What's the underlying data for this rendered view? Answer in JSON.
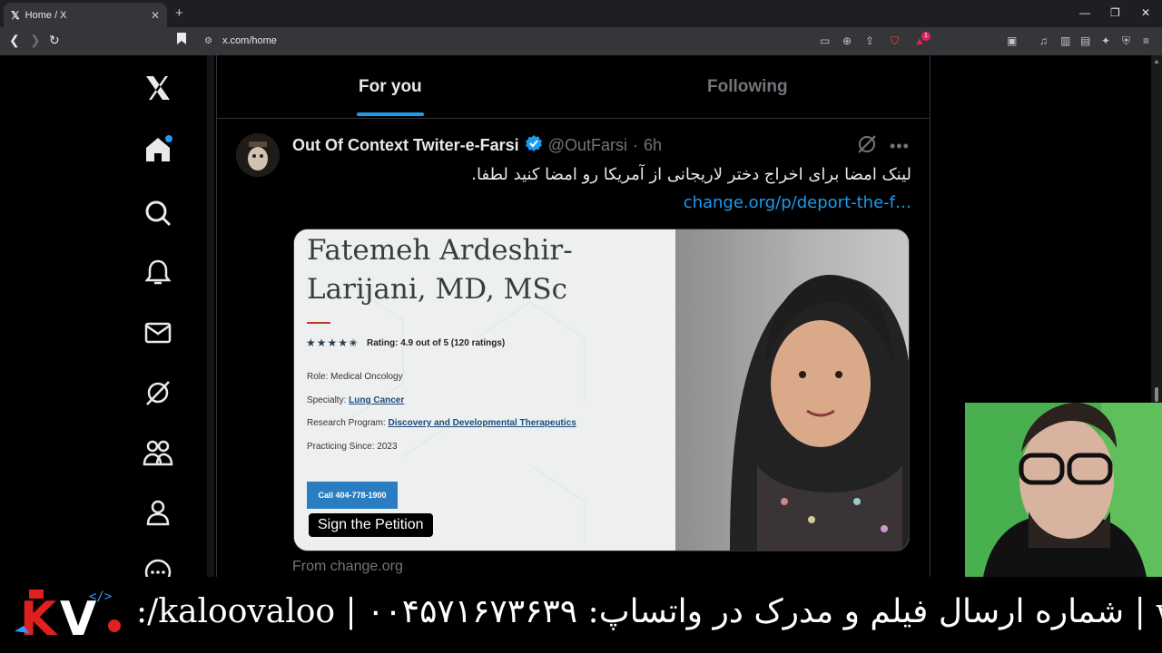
{
  "browser": {
    "tab_title": "Home / X",
    "tab_icon": "x-logo-icon",
    "url": "x.com/home",
    "notification_badge": "1"
  },
  "timeline": {
    "tabs": [
      {
        "label": "For you",
        "active": true
      },
      {
        "label": "Following",
        "active": false
      }
    ]
  },
  "tweet": {
    "author_name": "Out Of Context Twiter-e-Farsi",
    "verified": true,
    "handle": "@OutFarsi",
    "separator": "·",
    "time": "6h",
    "text_prefix": "لینک امضا برای اخراج دختر لاریجانی از آمریکا رو امضا کنید لطفا.",
    "link_text": "change.org/p/deport-the-f…",
    "card": {
      "doctor_name": "Fatemeh Ardeshir-Larijani, MD, MSc",
      "rating_text": "Rating: 4.9 out of 5 (120 ratings)",
      "role_label": "Role: Medical Oncology",
      "specialty_prefix": "Specialty:",
      "specialty_value": "Lung Cancer",
      "program_prefix": "Research Program:",
      "program_value": "Discovery and Developmental Therapeutics",
      "practicing": "Practicing Since: 2023",
      "call_button": "Call 404-778-1900",
      "petition_label": "Sign the Petition"
    },
    "from_line": "From change.org"
  },
  "banner": {
    "text": ":/kaloovaloo | ۰۰۴۵۷۱۶۷۳۶۳۹ :شماره ارسال فیلم و مدرک در واتساپ | www.lin"
  },
  "colors": {
    "accent": "#1d9bf0",
    "background": "#000000"
  }
}
